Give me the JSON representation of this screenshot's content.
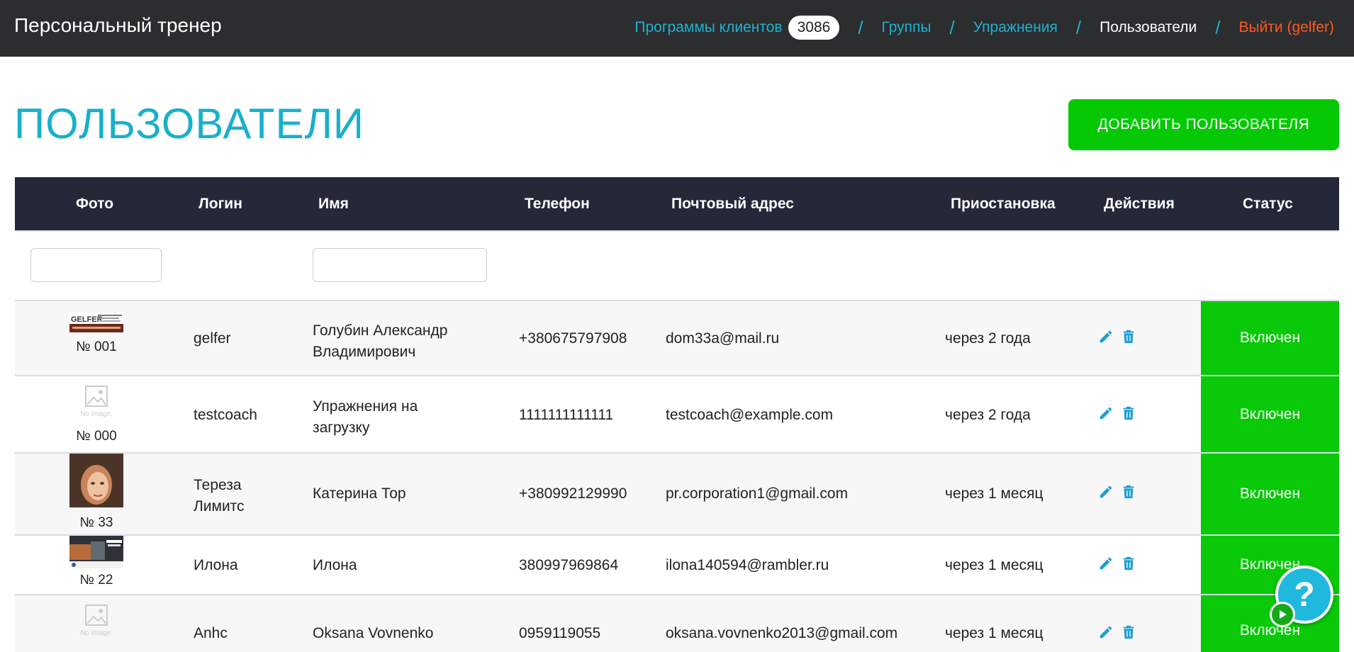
{
  "brand": "Персональный тренер",
  "nav": {
    "programs": "Программы клиентов",
    "programs_count": "3086",
    "groups": "Группы",
    "exercises": "Упражнения",
    "users": "Пользователи",
    "logout": "Выйти (gelfer)",
    "sep": "/"
  },
  "page": {
    "title": "ПОЛЬЗОВАТЕЛИ",
    "add_button": "ДОБАВИТЬ ПОЛЬЗОВАТЕЛЯ"
  },
  "table": {
    "headers": {
      "photo": "Фото",
      "login": "Логин",
      "name": "Имя",
      "phone": "Телефон",
      "email": "Почтовый адрес",
      "suspend": "Приостановка",
      "actions": "Действия",
      "status": "Статус"
    },
    "rows": [
      {
        "photo_no": "№ 001",
        "login": "gelfer",
        "name": "Голубин Александр Владимирович",
        "phone": "+380675797908",
        "email": "dom33a@mail.ru",
        "suspend": "через 2 года",
        "status": "Включен",
        "photo_logo_text": "GELFER"
      },
      {
        "photo_no": "№ 000",
        "login": "testcoach",
        "name": "Упражнения на загрузку",
        "phone": "1111111111111",
        "email": "testcoach@example.com",
        "suspend": "через 2 года",
        "status": "Включен",
        "photo_placeholder": "No image."
      },
      {
        "photo_no": "№ 33",
        "login": "Тереза Лимитс",
        "name": "Катерина Тор",
        "phone": "+380992129990",
        "email": "pr.corporation1@gmail.com",
        "suspend": "через 1 месяц",
        "status": "Включен"
      },
      {
        "photo_no": "№ 22",
        "login": "Илона",
        "name": "Илона",
        "phone": "380997969864",
        "email": "ilona140594@rambler.ru",
        "suspend": "через 1 месяц",
        "status": "Включен"
      },
      {
        "photo_no": "",
        "login": "Anhc",
        "name": "Oksana Vovnenko",
        "phone": "0959119055",
        "email": "oksana.vovnenko2013@gmail.com",
        "suspend": "через 1 месяц",
        "status": "Включен",
        "photo_placeholder": "No image."
      }
    ]
  },
  "help": {
    "label": "?"
  },
  "colors": {
    "accent": "#19b0cb",
    "success": "#09c909",
    "header_bg": "#242838",
    "logout": "#ff5a1f"
  }
}
